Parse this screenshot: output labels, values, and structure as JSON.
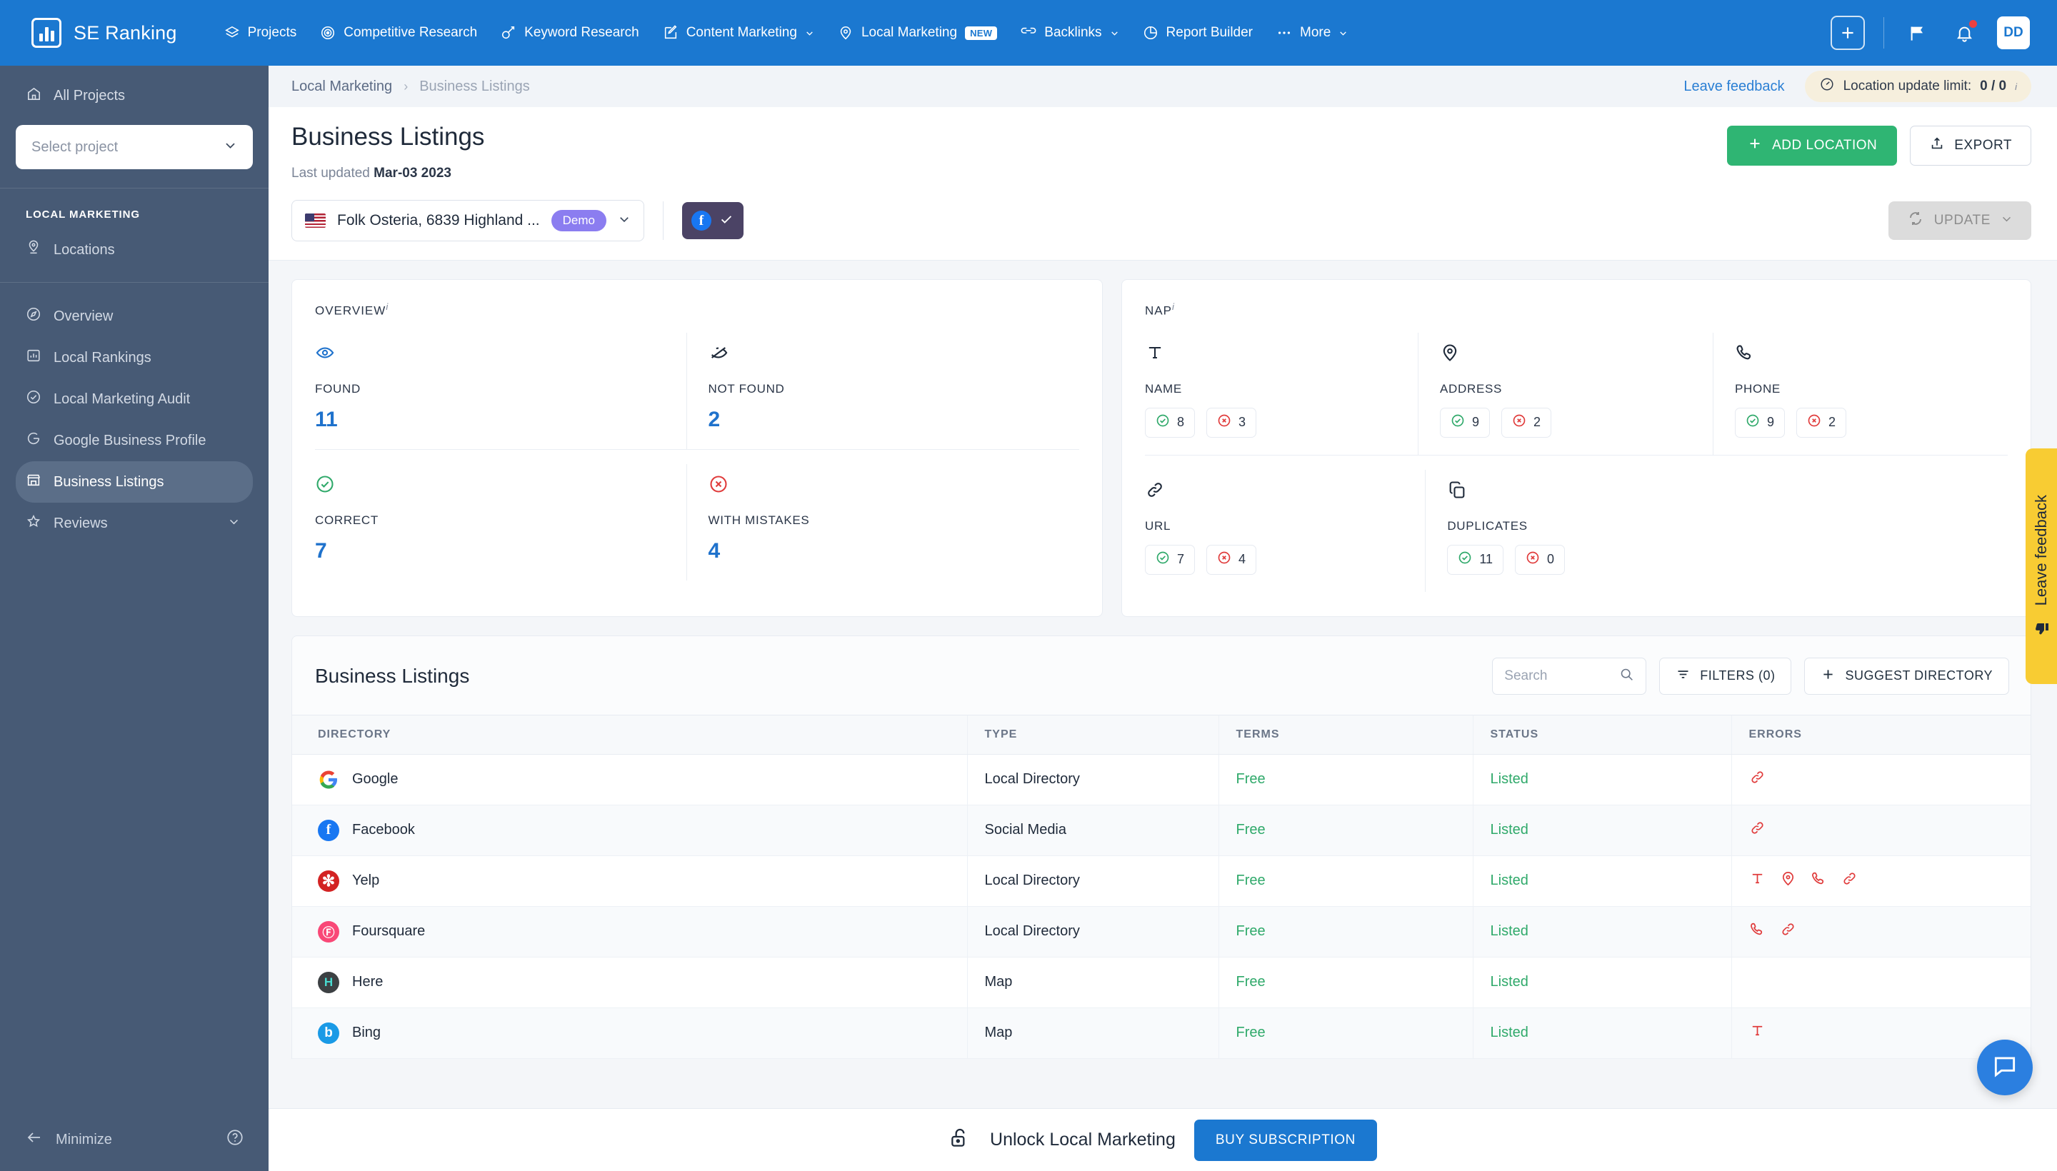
{
  "topnav": {
    "brand": "SE Ranking",
    "items": [
      {
        "label": "Projects",
        "icon": "layers-icon",
        "caret": false,
        "badge": null
      },
      {
        "label": "Competitive Research",
        "icon": "target-icon",
        "caret": false,
        "badge": null
      },
      {
        "label": "Keyword Research",
        "icon": "key-icon",
        "caret": false,
        "badge": null
      },
      {
        "label": "Content Marketing",
        "icon": "edit-square-icon",
        "caret": true,
        "badge": null
      },
      {
        "label": "Local Marketing",
        "icon": "map-pin-icon",
        "caret": false,
        "badge": "NEW"
      },
      {
        "label": "Backlinks",
        "icon": "link-icon",
        "caret": true,
        "badge": null
      },
      {
        "label": "Report Builder",
        "icon": "pie-chart-icon",
        "caret": false,
        "badge": null
      },
      {
        "label": "More",
        "icon": "ellipsis-icon",
        "caret": true,
        "badge": null
      }
    ],
    "avatar_initials": "DD",
    "accent": "#1b78d0"
  },
  "sidebar": {
    "all_projects": "All Projects",
    "project_placeholder": "Select project",
    "section_title": "LOCAL MARKETING",
    "locations_label": "Locations",
    "items": [
      {
        "label": "Overview",
        "icon": "compass-icon",
        "active": false,
        "caret": false
      },
      {
        "label": "Local Rankings",
        "icon": "bar-chart-icon",
        "active": false,
        "caret": false
      },
      {
        "label": "Local Marketing Audit",
        "icon": "check-circle-icon",
        "active": false,
        "caret": false
      },
      {
        "label": "Google Business Profile",
        "icon": "google-g-icon",
        "active": false,
        "caret": false
      },
      {
        "label": "Business Listings",
        "icon": "storefront-icon",
        "active": true,
        "caret": false
      },
      {
        "label": "Reviews",
        "icon": "star-icon",
        "active": false,
        "caret": true
      }
    ],
    "minimize_label": "Minimize"
  },
  "breadcrumb": {
    "parent": "Local Marketing",
    "separator": "›",
    "current": "Business Listings",
    "leave_feedback": "Leave feedback",
    "limit_label": "Location update limit:",
    "limit_value": "0 / 0"
  },
  "header": {
    "title": "Business Listings",
    "last_updated_label": "Last updated",
    "last_updated_value": "Mar-03 2023",
    "add_location": "ADD LOCATION",
    "export": "EXPORT"
  },
  "location_bar": {
    "flag": "us-flag-icon",
    "name": "Folk Osteria, 6839 Highland ...",
    "demo_badge": "Demo",
    "facebook_connected": true,
    "update_label": "UPDATE"
  },
  "overview_card": {
    "title": "OVERVIEW",
    "cells": [
      {
        "icon": "eye-icon",
        "label": "FOUND",
        "value": "11",
        "color": "#1f72cc"
      },
      {
        "icon": "eye-off-icon",
        "label": "NOT FOUND",
        "value": "2",
        "color": "#1f2a3a"
      },
      {
        "icon": "check-circle-icon",
        "label": "CORRECT",
        "value": "7",
        "color": "#2fa96a"
      },
      {
        "icon": "x-circle-icon",
        "label": "WITH MISTAKES",
        "value": "4",
        "color": "#e03b3b"
      }
    ]
  },
  "nap_card": {
    "title": "NAP",
    "cells": [
      {
        "icon": "text-t-icon",
        "label": "NAME",
        "ok": "8",
        "bad": "3"
      },
      {
        "icon": "map-pin-icon",
        "label": "ADDRESS",
        "ok": "9",
        "bad": "2"
      },
      {
        "icon": "phone-icon",
        "label": "PHONE",
        "ok": "9",
        "bad": "2"
      },
      {
        "icon": "link-icon",
        "label": "URL",
        "ok": "7",
        "bad": "4"
      },
      {
        "icon": "copy-icon",
        "label": "DUPLICATES",
        "ok": "11",
        "bad": "0"
      }
    ]
  },
  "listings_panel": {
    "title": "Business Listings",
    "search_placeholder": "Search",
    "search_value": "",
    "filters_label": "FILTERS (0)",
    "suggest_label": "SUGGEST DIRECTORY",
    "columns": [
      "DIRECTORY",
      "TYPE",
      "TERMS",
      "STATUS",
      "ERRORS"
    ],
    "rows": [
      {
        "directory": "Google",
        "logo": "google-logo-icon",
        "type": "Local Directory",
        "terms": "Free",
        "status": "Listed",
        "errors": [
          "link-icon"
        ]
      },
      {
        "directory": "Facebook",
        "logo": "facebook-logo-icon",
        "type": "Social Media",
        "terms": "Free",
        "status": "Listed",
        "errors": [
          "link-icon"
        ]
      },
      {
        "directory": "Yelp",
        "logo": "yelp-logo-icon",
        "type": "Local Directory",
        "terms": "Free",
        "status": "Listed",
        "errors": [
          "text-t-icon",
          "map-pin-icon",
          "phone-icon",
          "link-icon"
        ]
      },
      {
        "directory": "Foursquare",
        "logo": "foursquare-logo-icon",
        "type": "Local Directory",
        "terms": "Free",
        "status": "Listed",
        "errors": [
          "phone-icon",
          "link-icon"
        ]
      },
      {
        "directory": "Here",
        "logo": "here-logo-icon",
        "type": "Map",
        "terms": "Free",
        "status": "Listed",
        "errors": []
      },
      {
        "directory": "Bing",
        "logo": "bing-logo-icon",
        "type": "Map",
        "terms": "Free",
        "status": "Listed",
        "errors": [
          "text-t-icon"
        ]
      }
    ]
  },
  "feedback_tab": {
    "label": "Leave feedback"
  },
  "bottom_bar": {
    "unlock_text": "Unlock Local Marketing",
    "buy_label": "BUY SUBSCRIPTION"
  }
}
